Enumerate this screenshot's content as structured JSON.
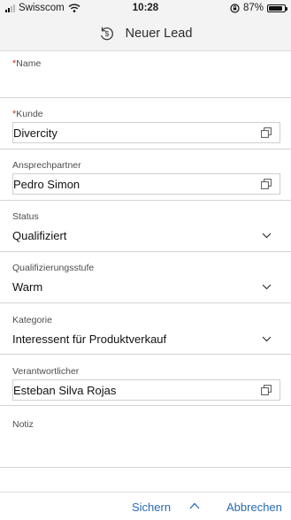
{
  "status_bar": {
    "carrier": "Swisscom",
    "time": "10:28",
    "battery": "87%",
    "battery_level": 0.87
  },
  "header": {
    "title": "Neuer Lead",
    "icon": "lead-icon"
  },
  "form": {
    "name": {
      "label": "Name",
      "required": "*",
      "value": ""
    },
    "kunde": {
      "label": "Kunde",
      "required": "*",
      "value": "Divercity"
    },
    "ansprechpartner": {
      "label": "Ansprechpartner",
      "value": "Pedro Simon"
    },
    "status": {
      "label": "Status",
      "value": "Qualifiziert"
    },
    "qualifizierungsstufe": {
      "label": "Qualifizierungsstufe",
      "value": "Warm"
    },
    "kategorie": {
      "label": "Kategorie",
      "value": "Interessent für Produktverkauf"
    },
    "verantwortlicher": {
      "label": "Verantwortlicher",
      "value": "Esteban Silva Rojas"
    },
    "notiz": {
      "label": "Notiz",
      "value": ""
    }
  },
  "footer": {
    "save_label": "Sichern",
    "cancel_label": "Abbrechen"
  },
  "colors": {
    "accent": "#2a6ab4",
    "required": "#c0392b"
  }
}
